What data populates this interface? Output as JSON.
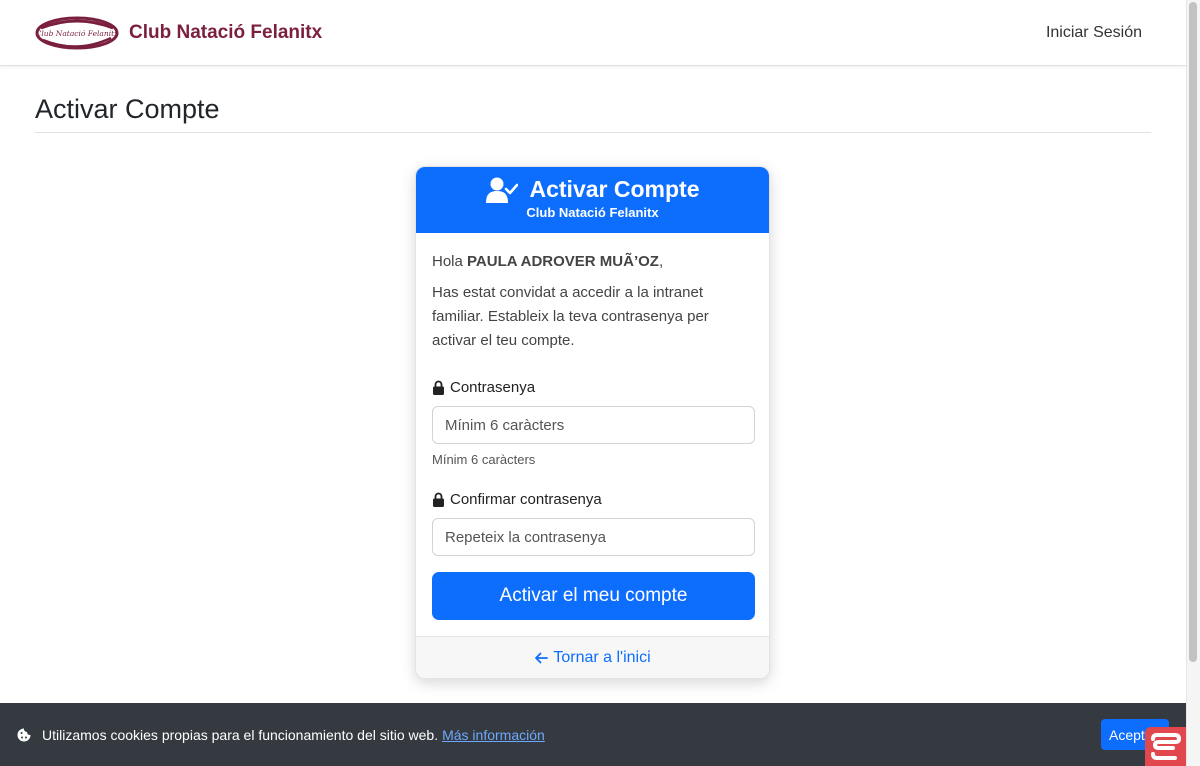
{
  "navbar": {
    "logo_text": "Club Natació Felanitx",
    "brand_name": "Club Natació Felanitx",
    "login_link": "Iniciar Sesión"
  },
  "page": {
    "title": "Activar Compte"
  },
  "card": {
    "header_icon": "user-check-icon",
    "title": "Activar Compte",
    "subtitle": "Club Natació Felanitx",
    "greeting_prefix": "Hola",
    "user_name": "PAULA ADROVER MUÃ’OZ",
    "greeting_suffix": ",",
    "intro": "Has estat convidat a accedir a la intranet familiar. Estableix la teva contrasenya per activar el teu compte.",
    "password_label": "Contrasenya",
    "password_placeholder": "Mínim 6 caràcters",
    "password_hint": "Mínim 6 caràcters",
    "confirm_label": "Confirmar contrasenya",
    "confirm_placeholder": "Repeteix la contrasenya",
    "submit_label": "Activar el meu compte",
    "back_link": "Tornar a l'inici"
  },
  "cookie_bar": {
    "icon": "cookie-icon",
    "text": "Utilizamos cookies propias para el funcionamiento del sitio web.",
    "link": "Más información",
    "accept_label": "Aceptar"
  },
  "colors": {
    "primary": "#0d6efd",
    "brand": "#7a1f3d",
    "cookie_bg": "#343a40",
    "help_widget": "#e0484d"
  }
}
